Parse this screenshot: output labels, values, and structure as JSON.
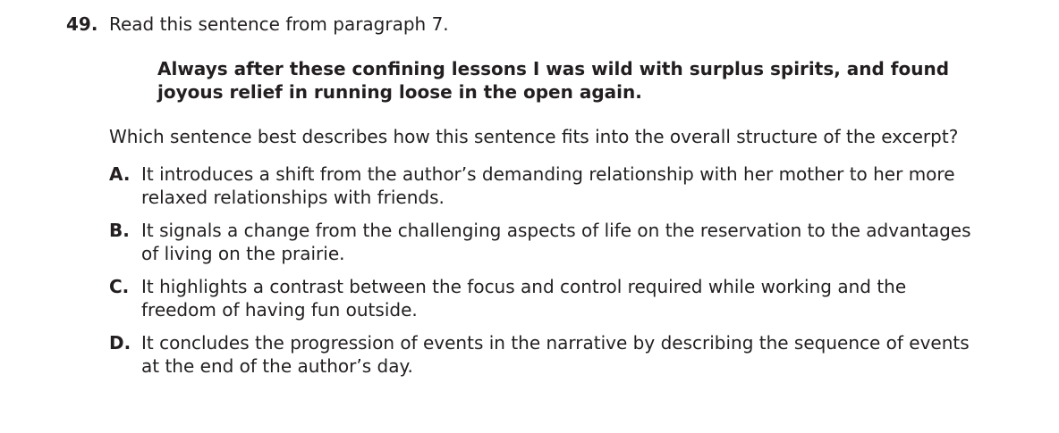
{
  "question": {
    "number": "49.",
    "prompt": "Read this sentence from paragraph 7.",
    "quote": "Always after these confining lessons I was wild with surplus spirits, and found joyous relief in running loose in the open again.",
    "stem": "Which sentence best describes how this sentence fits into the overall structure of the excerpt?"
  },
  "options": [
    {
      "letter": "A.",
      "text": "It introduces a shift from the author’s demanding relationship with her mother to her more relaxed relationships with friends."
    },
    {
      "letter": "B.",
      "text": "It signals a change from the challenging aspects of life on the reservation to the advantages of living on the prairie."
    },
    {
      "letter": "C.",
      "text": "It highlights a contrast between the focus and control required while working and the freedom of having fun outside."
    },
    {
      "letter": "D.",
      "text": "It concludes the progression of events in the narrative by describing the sequence of events at the end of the author’s day."
    }
  ]
}
